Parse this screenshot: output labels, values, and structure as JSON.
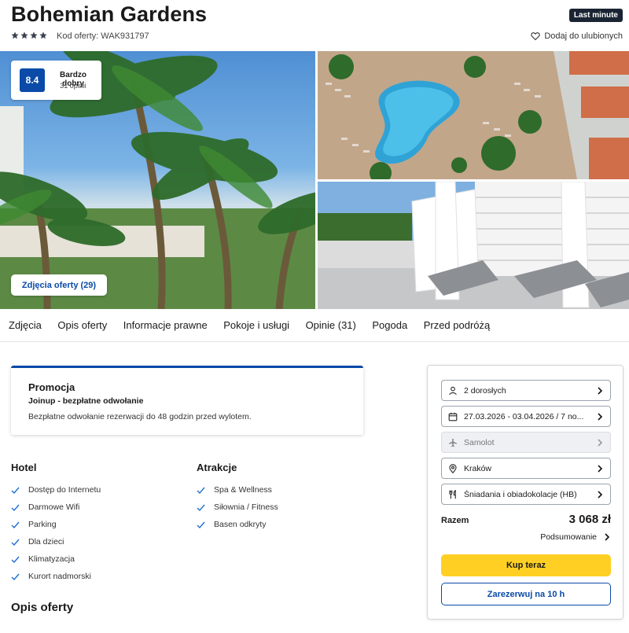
{
  "header": {
    "title": "Bohemian Gardens",
    "badge": "Last minute",
    "stars": 4,
    "offer_code": "Kod oferty: WAK931797",
    "favorite_label": "Dodaj do ulubionych"
  },
  "rating": {
    "score": "8.4",
    "label": "Bardzo dobry",
    "count": "31 opinii"
  },
  "gallery": {
    "photos_button": "Zdjęcia oferty (29)"
  },
  "tabs": [
    {
      "label": "Zdjęcia"
    },
    {
      "label": "Opis oferty"
    },
    {
      "label": "Informacje prawne"
    },
    {
      "label": "Pokoje i usługi"
    },
    {
      "label": "Opinie (31)"
    },
    {
      "label": "Pogoda"
    },
    {
      "label": "Przed podróżą"
    }
  ],
  "promo": {
    "title": "Promocja",
    "subtitle": "Joinup - bezpłatne odwołanie",
    "text": "Bezpłatne odwołanie rezerwacji do 48 godzin przed wylotem."
  },
  "hotel": {
    "heading": "Hotel",
    "items": [
      "Dostęp do Internetu",
      "Darmowe Wifi",
      "Parking",
      "Dla dzieci",
      "Klimatyzacja",
      "Kurort nadmorski"
    ]
  },
  "attractions": {
    "heading": "Atrakcje",
    "items": [
      "Spa & Wellness",
      "Siłownia / Fitness",
      "Basen odkryty"
    ]
  },
  "description": {
    "heading": "Opis oferty"
  },
  "booking": {
    "options": [
      {
        "icon": "person-icon",
        "label": "2 dorosłych",
        "disabled": false
      },
      {
        "icon": "calendar-icon",
        "label": "27.03.2026 - 03.04.2026 / 7 no...",
        "disabled": false
      },
      {
        "icon": "plane-icon",
        "label": "Samolot",
        "disabled": true
      },
      {
        "icon": "location-pin-icon",
        "label": "Kraków",
        "disabled": false
      },
      {
        "icon": "cutlery-icon",
        "label": "Śniadania i obiadokolacje (HB)",
        "disabled": false
      }
    ],
    "total_label": "Razem",
    "total_value": "3 068 zł",
    "summary_label": "Podsumowanie",
    "buy_label": "Kup teraz",
    "reserve_label": "Zarezerwuj na 10 h"
  },
  "colors": {
    "brand_blue": "#0a4aa8",
    "buy_yellow": "#ffd023",
    "badge_dark": "#1a2433",
    "check_blue": "#1f6fd1"
  }
}
